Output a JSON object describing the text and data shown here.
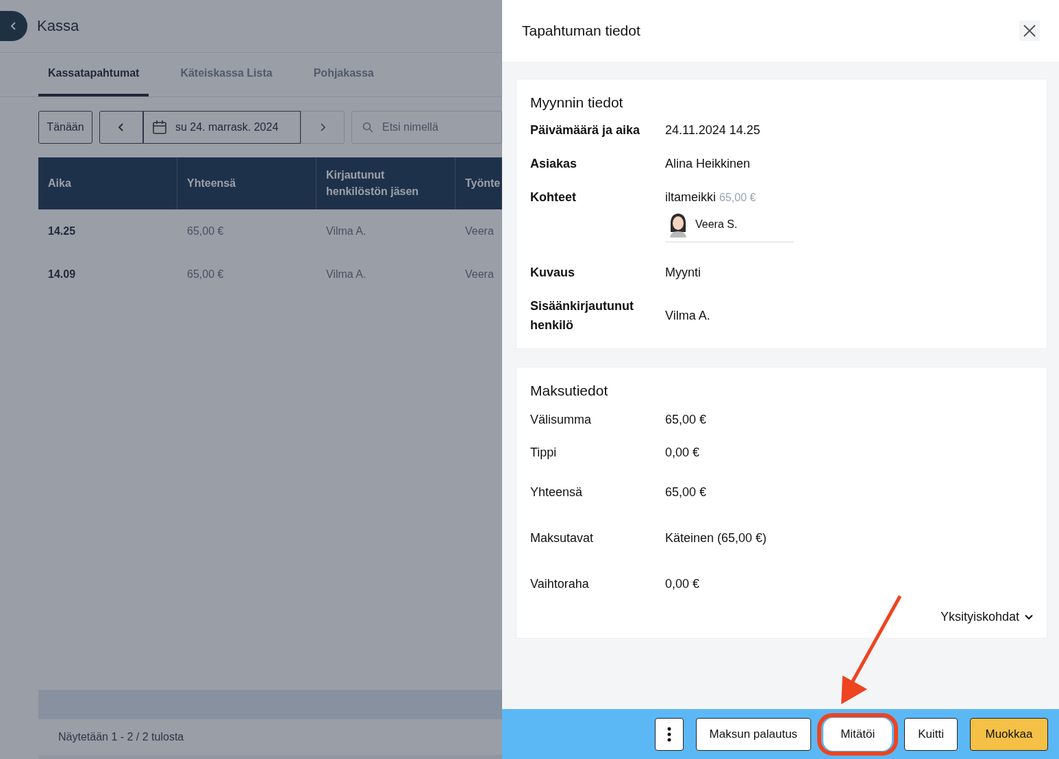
{
  "page": {
    "title": "Kassa"
  },
  "tabs": [
    {
      "label": "Kassatapahtumat",
      "selected": true
    },
    {
      "label": "Käteiskassa Lista",
      "selected": false
    },
    {
      "label": "Pohjakassa",
      "selected": false
    }
  ],
  "toolbar": {
    "today_button": "Tänään",
    "date": "su 24. marrask. 2024",
    "search": {
      "placeholder": "Etsi nimellä"
    }
  },
  "table": {
    "columns": [
      "Aika",
      "Yhteensä",
      "Kirjautunut henkilöstön jäsen",
      "Työnte"
    ],
    "rows": [
      [
        "14.25",
        "65,00 €",
        "Vilma A.",
        "Veera"
      ],
      [
        "14.09",
        "65,00 €",
        "Vilma A.",
        "Veera"
      ]
    ],
    "footer": "Näytetään 1 - 2 / 2 tulosta"
  },
  "panel": {
    "title": "Tapahtuman tiedot",
    "sales": {
      "heading": "Myynnin tiedot",
      "fields": [
        {
          "kind": "text",
          "label": "Päivämäärä ja aika",
          "value": "24.11.2024 14.25"
        },
        {
          "kind": "text",
          "label": "Asiakas",
          "value": "Alina Heikkinen"
        },
        {
          "kind": "items",
          "label": "Kohteet",
          "items": [
            {
              "name": "iltameikki",
              "price": "65,00 €",
              "staff": "Veera S."
            }
          ]
        },
        {
          "kind": "text",
          "label": "Kuvaus",
          "value": "Myynti"
        },
        {
          "kind": "text",
          "label": "Sisäänkirjautunut henkilö",
          "value": "Vilma A."
        }
      ]
    },
    "payment": {
      "heading": "Maksutiedot",
      "rows": [
        {
          "label": "Välisumma",
          "value": "65,00 €"
        },
        {
          "label": "Tippi",
          "value": "0,00 €"
        },
        {
          "label": "Yhteensä",
          "value": "65,00 €"
        },
        {
          "label": "Maksutavat",
          "value": "Käteinen (65,00 €)"
        },
        {
          "label": "Vaihtoraha",
          "value": "0,00 €"
        }
      ],
      "details_toggle": "Yksityiskohdat"
    },
    "actions": [
      {
        "kind": "more",
        "highlighted": false
      },
      {
        "kind": "secondary",
        "label": "Maksun palautus",
        "highlighted": false
      },
      {
        "kind": "secondary",
        "label": "Mitätöi",
        "highlighted": true
      },
      {
        "kind": "secondary",
        "label": "Kuitti",
        "highlighted": false
      },
      {
        "kind": "primary",
        "label": "Muokkaa",
        "highlighted": false
      }
    ]
  }
}
